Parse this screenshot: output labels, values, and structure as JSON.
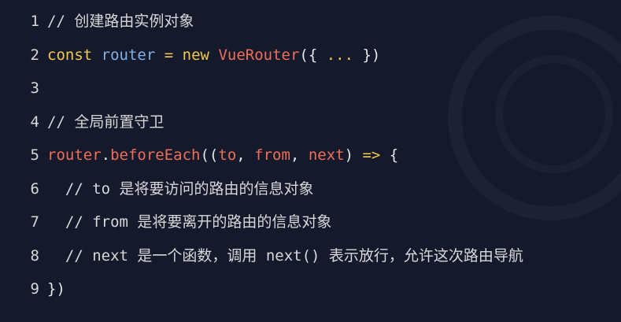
{
  "colors": {
    "background": "#14192c",
    "comment": "#d8d8d8",
    "keyword": "#f2c94c",
    "variable": "#7fb2e8",
    "class_name": "#ee6f57",
    "text": "#e6e6e6"
  },
  "lines": [
    {
      "number": "1",
      "tokens": [
        {
          "text": "// 创建路由实例对象",
          "kind": "comment"
        }
      ]
    },
    {
      "number": "2",
      "tokens": [
        {
          "text": "const",
          "kind": "kw"
        },
        {
          "text": " ",
          "kind": "plain"
        },
        {
          "text": "router",
          "kind": "var"
        },
        {
          "text": " ",
          "kind": "plain"
        },
        {
          "text": "=",
          "kind": "op"
        },
        {
          "text": " ",
          "kind": "plain"
        },
        {
          "text": "new",
          "kind": "kw"
        },
        {
          "text": " ",
          "kind": "plain"
        },
        {
          "text": "VueRouter",
          "kind": "cls"
        },
        {
          "text": "({ ",
          "kind": "punc"
        },
        {
          "text": "...",
          "kind": "op"
        },
        {
          "text": " })",
          "kind": "punc"
        }
      ]
    },
    {
      "number": "3",
      "tokens": []
    },
    {
      "number": "4",
      "tokens": [
        {
          "text": "// 全局前置守卫",
          "kind": "comment"
        }
      ]
    },
    {
      "number": "5",
      "tokens": [
        {
          "text": "router",
          "kind": "fn"
        },
        {
          "text": ".",
          "kind": "punc"
        },
        {
          "text": "beforeEach",
          "kind": "fn"
        },
        {
          "text": "((",
          "kind": "punc"
        },
        {
          "text": "to",
          "kind": "param"
        },
        {
          "text": ", ",
          "kind": "punc"
        },
        {
          "text": "from",
          "kind": "param"
        },
        {
          "text": ", ",
          "kind": "punc"
        },
        {
          "text": "next",
          "kind": "param"
        },
        {
          "text": ") ",
          "kind": "punc"
        },
        {
          "text": "=>",
          "kind": "op"
        },
        {
          "text": " {",
          "kind": "punc"
        }
      ]
    },
    {
      "number": "6",
      "tokens": [
        {
          "text": "  // to 是将要访问的路由的信息对象",
          "kind": "comment"
        }
      ]
    },
    {
      "number": "7",
      "tokens": [
        {
          "text": "  // from 是将要离开的路由的信息对象",
          "kind": "comment"
        }
      ]
    },
    {
      "number": "8",
      "tokens": [
        {
          "text": "  // next 是一个函数，调用 next() 表示放行，允许这次路由导航",
          "kind": "comment"
        }
      ]
    },
    {
      "number": "9",
      "tokens": [
        {
          "text": "})",
          "kind": "punc"
        }
      ]
    }
  ]
}
